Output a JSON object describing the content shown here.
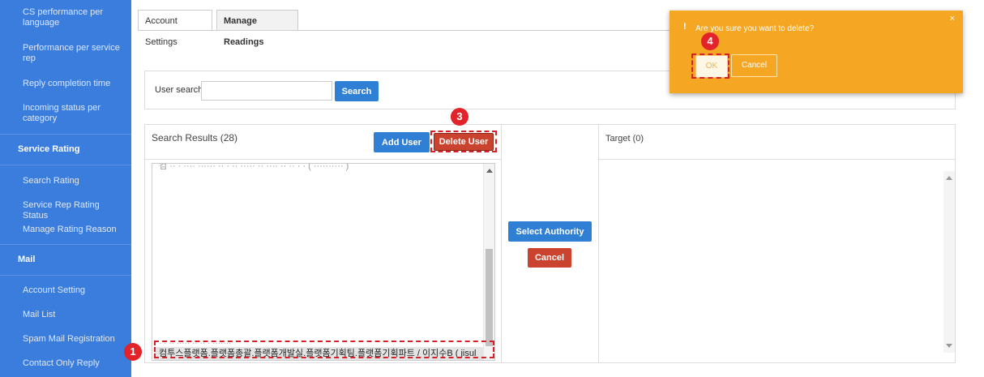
{
  "sidebar": {
    "items_top": [
      "CS performance per language",
      "Performance per service rep",
      "Reply completion time",
      "Incoming status per category"
    ],
    "section_service_rating": "Service Rating",
    "service_rating_items": [
      "Search Rating",
      "Service Rep Rating Status",
      "Manage Rating Reason"
    ],
    "section_mail": "Mail",
    "mail_items": [
      "Account Setting",
      "Mail List",
      "Spam Mail Registration",
      "Contact Only Reply"
    ]
  },
  "tabs": [
    {
      "label": "Account Settings",
      "active": false
    },
    {
      "label": "Manage Readings",
      "active": true
    }
  ],
  "search": {
    "label": "User search",
    "value": "",
    "button": "Search"
  },
  "results": {
    "title": "Search Results (28)",
    "add_user": "Add User",
    "delete_user": "Delete User",
    "partial_top": "컴 ·· · ···· ······ ·· · ·· ····· ·· ···· ·· ·· · · ( ·········· )",
    "partial_bottom": "· · ·· ····· ·· ·· · ·······",
    "selected_row": "컴투스플랫폼.플랫폼총괄.플랫폼개발실.플랫폼기획팀.플랫폼기획파트 / 이지수B ( jisul"
  },
  "middle": {
    "select_authority": "Select Authority",
    "cancel": "Cancel"
  },
  "target": {
    "title": "Target (0)"
  },
  "dialog": {
    "icon": "!",
    "message": "Are you sure you want to delete?",
    "close": "×",
    "ok": "OK",
    "cancel": "Cancel"
  },
  "markers": {
    "m1": "1",
    "m3": "3",
    "m4": "4"
  },
  "colors": {
    "sidebar": "#3b7ddd",
    "primary_button": "#2f7fd4",
    "danger_button": "#c9432e",
    "dialog": "#f5a623",
    "annotation": "#e2232a"
  }
}
